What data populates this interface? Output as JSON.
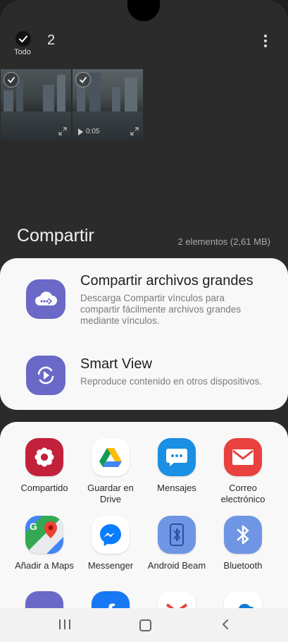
{
  "header": {
    "select_all_label": "Todo",
    "selected_count": "2"
  },
  "thumbnails": [
    {
      "type": "image"
    },
    {
      "type": "video",
      "duration": "0:05"
    }
  ],
  "share": {
    "title": "Compartir",
    "summary": "2 elementos (2,61 MB)"
  },
  "options": [
    {
      "title": "Compartir archivos grandes",
      "description": "Descarga Compartir vínculos para compartir fácilmente archivos grandes mediante vínculos.",
      "icon": "cloud-link-icon"
    },
    {
      "title": "Smart View",
      "description": "Reproduce contenido en otros dispositivos.",
      "icon": "smart-view-icon"
    }
  ],
  "apps": [
    {
      "label": "Compartido",
      "icon": "flower-icon",
      "color": "#c3213b"
    },
    {
      "label": "Guardar en Drive",
      "icon": "drive-icon",
      "color": "#ffffff"
    },
    {
      "label": "Mensajes",
      "icon": "message-icon",
      "color": "#1a8fe3"
    },
    {
      "label": "Correo electrónico",
      "icon": "mail-icon",
      "color": "#e8413e"
    },
    {
      "label": "Añadir a Maps",
      "icon": "maps-icon",
      "color": "#ffffff"
    },
    {
      "label": "Messenger",
      "icon": "messenger-icon",
      "color": "#ffffff"
    },
    {
      "label": "Android Beam",
      "icon": "beam-icon",
      "color": "#6f96e4"
    },
    {
      "label": "Bluetooth",
      "icon": "bluetooth-icon",
      "color": "#6f96e4"
    }
  ],
  "colors": {
    "accent": "#6a69c8",
    "background_dim": "#2b2b2b",
    "sheet": "#f8f8f8"
  }
}
